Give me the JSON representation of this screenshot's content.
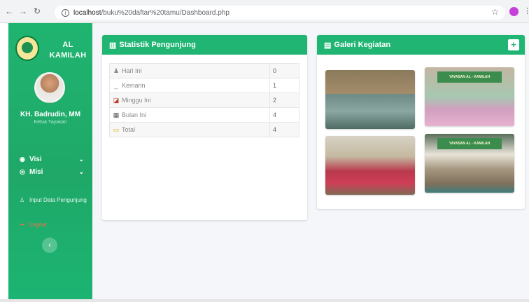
{
  "browser": {
    "url_host": "localhost",
    "url_path": "/buku%20daftar%20tamu/Dashboard.php"
  },
  "sidebar": {
    "brand_line1": "AL",
    "brand_line2": "KAMILAH",
    "user_name": "KH. Badrudin, MM",
    "user_role": "Ketua Yayasan",
    "menu": [
      {
        "label": "Visi",
        "icon": "eye-icon"
      },
      {
        "label": "Misi",
        "icon": "target-icon"
      }
    ],
    "input_data_label": "Input Data Pengunjung",
    "logout_label": "Logout"
  },
  "stats": {
    "title": "Statistik Pengunjung",
    "rows": [
      {
        "label": "Hari Ini",
        "value": "0",
        "icon": "user-icon"
      },
      {
        "label": "Kemarin",
        "value": "1",
        "icon": "dash-icon"
      },
      {
        "label": "Minggu Ini",
        "value": "2",
        "icon": "chart-icon"
      },
      {
        "label": "Bulan Ini",
        "value": "4",
        "icon": "calendar-icon"
      },
      {
        "label": "Total",
        "value": "4",
        "icon": "folder-icon"
      }
    ]
  },
  "gallery": {
    "title": "Galeri Kegiatan",
    "add_label": "+",
    "photo2_banner": "YAYASAN AL - KAMILAH",
    "photo4_banner": "YAYASAN AL - KAMILAH"
  },
  "colors": {
    "brand_green": "#21b573",
    "logout": "#ff6b4a"
  }
}
